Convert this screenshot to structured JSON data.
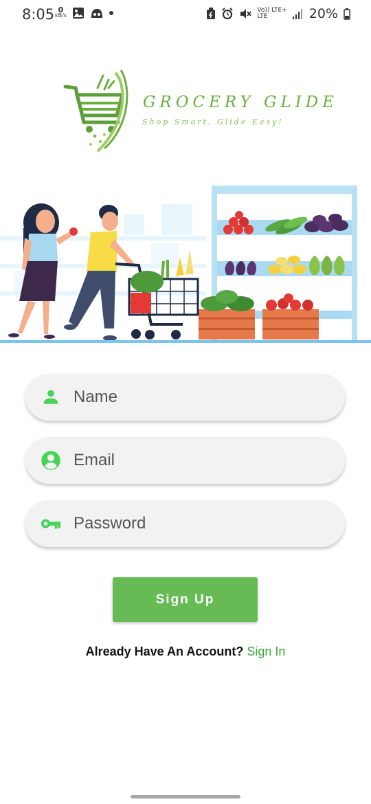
{
  "status_bar": {
    "time": "8:05",
    "net_speed_value": "0",
    "net_speed_unit": "kB/s",
    "signal_label_top": "Vo)) LTE+",
    "signal_label_bottom": "LTE",
    "battery_percent": "20%"
  },
  "brand": {
    "name": "GROCERY GLIDE",
    "tagline": "Shop Smart, Glide Easy!"
  },
  "form": {
    "name_placeholder": "Name",
    "email_placeholder": "Email",
    "password_placeholder": "Password",
    "signup_label": "Sign Up"
  },
  "footer": {
    "question": "Already Have An Account?",
    "signin_label": "Sign In"
  },
  "colors": {
    "accent_green": "#66bb55",
    "link_green": "#3aa935",
    "icon_green": "#46d35a",
    "field_bg": "#f2f2f2"
  },
  "icons": [
    "person-icon",
    "account-circle-icon",
    "key-icon"
  ]
}
